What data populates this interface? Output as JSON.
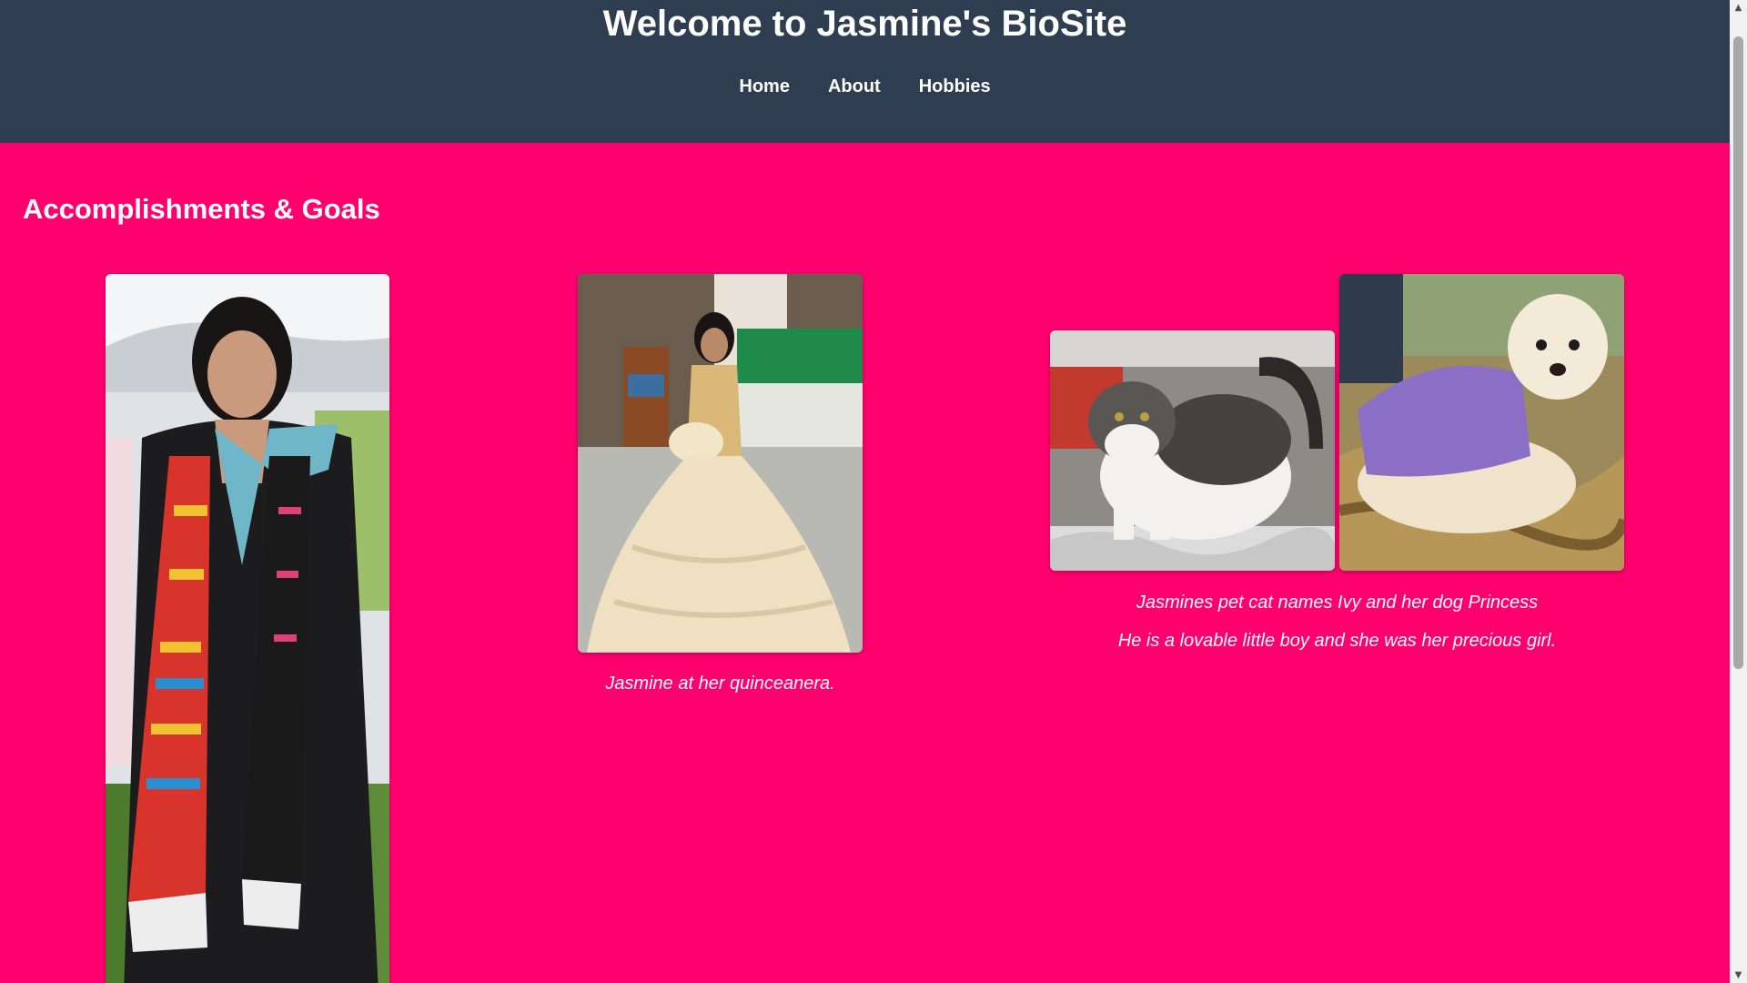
{
  "header": {
    "title": "Welcome to Jasmine's BioSite",
    "nav": [
      {
        "label": "Home"
      },
      {
        "label": "About"
      },
      {
        "label": "Hobbies"
      }
    ]
  },
  "main": {
    "section_title": "Accomplishments & Goals",
    "gallery": [
      {
        "caption": ""
      },
      {
        "caption": "Jasmine at her quinceanera."
      },
      {
        "captions": [
          "Jasmines pet cat names Ivy and her dog Princess",
          "He is a lovable little boy and she was her precious girl."
        ]
      }
    ]
  },
  "colors": {
    "header_bg": "#2e3d50",
    "page_bg": "#ff006e",
    "text": "#ffffff"
  },
  "icons": {
    "scroll_up": "scroll-up-arrow-icon",
    "scroll_down": "scroll-down-arrow-icon"
  }
}
